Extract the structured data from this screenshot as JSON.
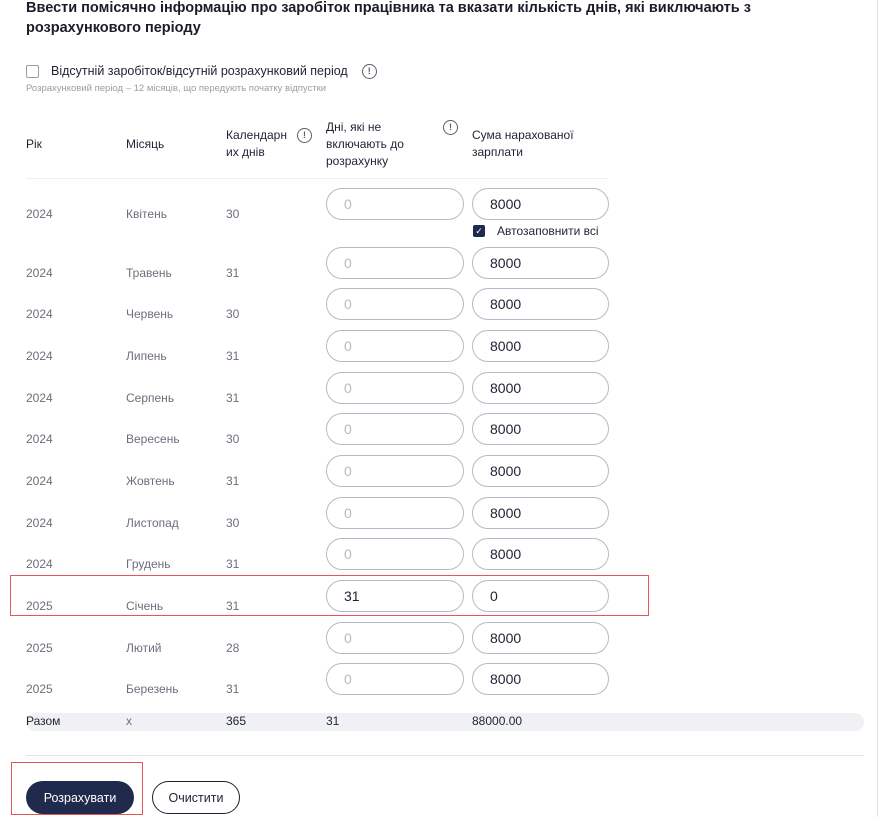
{
  "form": {
    "title": "Ввести помісячно інформацію про заробіток працівника та вказати кількість днів, які виключають з розрахункового періоду",
    "absent_label": "Відсутній заробіток/відсутній розрахунковий період",
    "hint": "Розрахунковий період – 12 місяців, що передують початку відпустки",
    "info_glyph": "!",
    "autofill_label": "Автозаповнити всі",
    "autofill_checked": true,
    "absent_checked": false
  },
  "columns": {
    "year": "Рік",
    "month": "Місяць",
    "calendar_days_l1": "Календарн",
    "calendar_days_l2": "их днів",
    "excluded_days_l1": "Дні, які не",
    "excluded_days_l2": "включають до",
    "excluded_days_l3": "розрахунку",
    "salary_l1": "Сума нарахованої",
    "salary_l2": "зарплати"
  },
  "rows": [
    {
      "year": "2024",
      "month": "Квітень",
      "days": "30",
      "excluded": "0",
      "excluded_filled": false,
      "salary": "8000"
    },
    {
      "year": "2024",
      "month": "Травень",
      "days": "31",
      "excluded": "0",
      "excluded_filled": false,
      "salary": "8000"
    },
    {
      "year": "2024",
      "month": "Червень",
      "days": "30",
      "excluded": "0",
      "excluded_filled": false,
      "salary": "8000"
    },
    {
      "year": "2024",
      "month": "Липень",
      "days": "31",
      "excluded": "0",
      "excluded_filled": false,
      "salary": "8000"
    },
    {
      "year": "2024",
      "month": "Серпень",
      "days": "31",
      "excluded": "0",
      "excluded_filled": false,
      "salary": "8000"
    },
    {
      "year": "2024",
      "month": "Вересень",
      "days": "30",
      "excluded": "0",
      "excluded_filled": false,
      "salary": "8000"
    },
    {
      "year": "2024",
      "month": "Жовтень",
      "days": "31",
      "excluded": "0",
      "excluded_filled": false,
      "salary": "8000"
    },
    {
      "year": "2024",
      "month": "Листопад",
      "days": "30",
      "excluded": "0",
      "excluded_filled": false,
      "salary": "8000"
    },
    {
      "year": "2024",
      "month": "Грудень",
      "days": "31",
      "excluded": "0",
      "excluded_filled": false,
      "salary": "8000"
    },
    {
      "year": "2025",
      "month": "Січень",
      "days": "31",
      "excluded": "31",
      "excluded_filled": true,
      "salary": "0"
    },
    {
      "year": "2025",
      "month": "Лютий",
      "days": "28",
      "excluded": "0",
      "excluded_filled": false,
      "salary": "8000"
    },
    {
      "year": "2025",
      "month": "Березень",
      "days": "31",
      "excluded": "0",
      "excluded_filled": false,
      "salary": "8000"
    }
  ],
  "totals": {
    "label": "Разом",
    "month": "х",
    "days": "365",
    "excluded": "31",
    "salary": "88000.00"
  },
  "actions": {
    "calculate": "Розрахувати",
    "clear": "Очистити"
  },
  "colors": {
    "primary": "#1f2a4d",
    "highlight": "#e3575b"
  }
}
